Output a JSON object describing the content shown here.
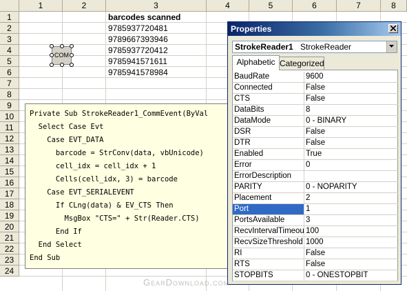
{
  "sheet": {
    "columns": [
      "1",
      "2",
      "3",
      "4",
      "5",
      "6",
      "7",
      "8"
    ],
    "rows": [
      "1",
      "2",
      "3",
      "4",
      "5",
      "6",
      "7",
      "8",
      "9",
      "10",
      "11",
      "12",
      "13",
      "14",
      "15",
      "16",
      "17",
      "18",
      "19",
      "20",
      "21",
      "22",
      "23",
      "24"
    ],
    "header": "barcodes scanned",
    "values": [
      "9785937720481",
      "9789667393946",
      "9785937720412",
      "9785941571611",
      "9785941578984"
    ]
  },
  "com_control": {
    "label": "COM"
  },
  "code": [
    "Private Sub StrokeReader1_CommEvent(ByVal",
    "  Select Case Evt",
    "    Case EVT_DATA",
    "      barcode = StrConv(data, vbUnicode)",
    "      cell_idx = cell_idx + 1",
    "      Cells(cell_idx, 3) = barcode",
    "    Case EVT_SERIALEVENT",
    "      If CLng(data) & EV_CTS Then",
    "        MsgBox \"CTS=\" + Str(Reader.CTS)",
    "      End If",
    "  End Select",
    "End Sub"
  ],
  "properties": {
    "title": "Properties",
    "object_name": "StrokeReader1",
    "object_type": "StrokeReader",
    "tabs": [
      "Alphabetic",
      "Categorized"
    ],
    "active_tab": 0,
    "selected": "Port",
    "rows": [
      {
        "name": "BaudRate",
        "value": "9600"
      },
      {
        "name": "Connected",
        "value": "False"
      },
      {
        "name": "CTS",
        "value": "False"
      },
      {
        "name": "DataBits",
        "value": "8"
      },
      {
        "name": "DataMode",
        "value": "0 - BINARY"
      },
      {
        "name": "DSR",
        "value": "False"
      },
      {
        "name": "DTR",
        "value": "False"
      },
      {
        "name": "Enabled",
        "value": "True"
      },
      {
        "name": "Error",
        "value": "0"
      },
      {
        "name": "ErrorDescription",
        "value": ""
      },
      {
        "name": "PARITY",
        "value": "0 - NOPARITY"
      },
      {
        "name": "Placement",
        "value": "2"
      },
      {
        "name": "Port",
        "value": "1"
      },
      {
        "name": "PortsAvailable",
        "value": "3"
      },
      {
        "name": "RecvIntervalTimeout",
        "value": "100"
      },
      {
        "name": "RecvSizeThreshold",
        "value": "1000"
      },
      {
        "name": "RI",
        "value": "False"
      },
      {
        "name": "RTS",
        "value": "False"
      },
      {
        "name": "STOPBITS",
        "value": "0 - ONESTOPBIT"
      }
    ]
  },
  "watermark": "GearDownload.com",
  "colors": {
    "titlebar": "#0a246a",
    "selection": "#316ac5",
    "code_bg": "#ffffe1"
  },
  "icons": {
    "close": "close-icon",
    "dropdown": "chevron-down-icon"
  }
}
